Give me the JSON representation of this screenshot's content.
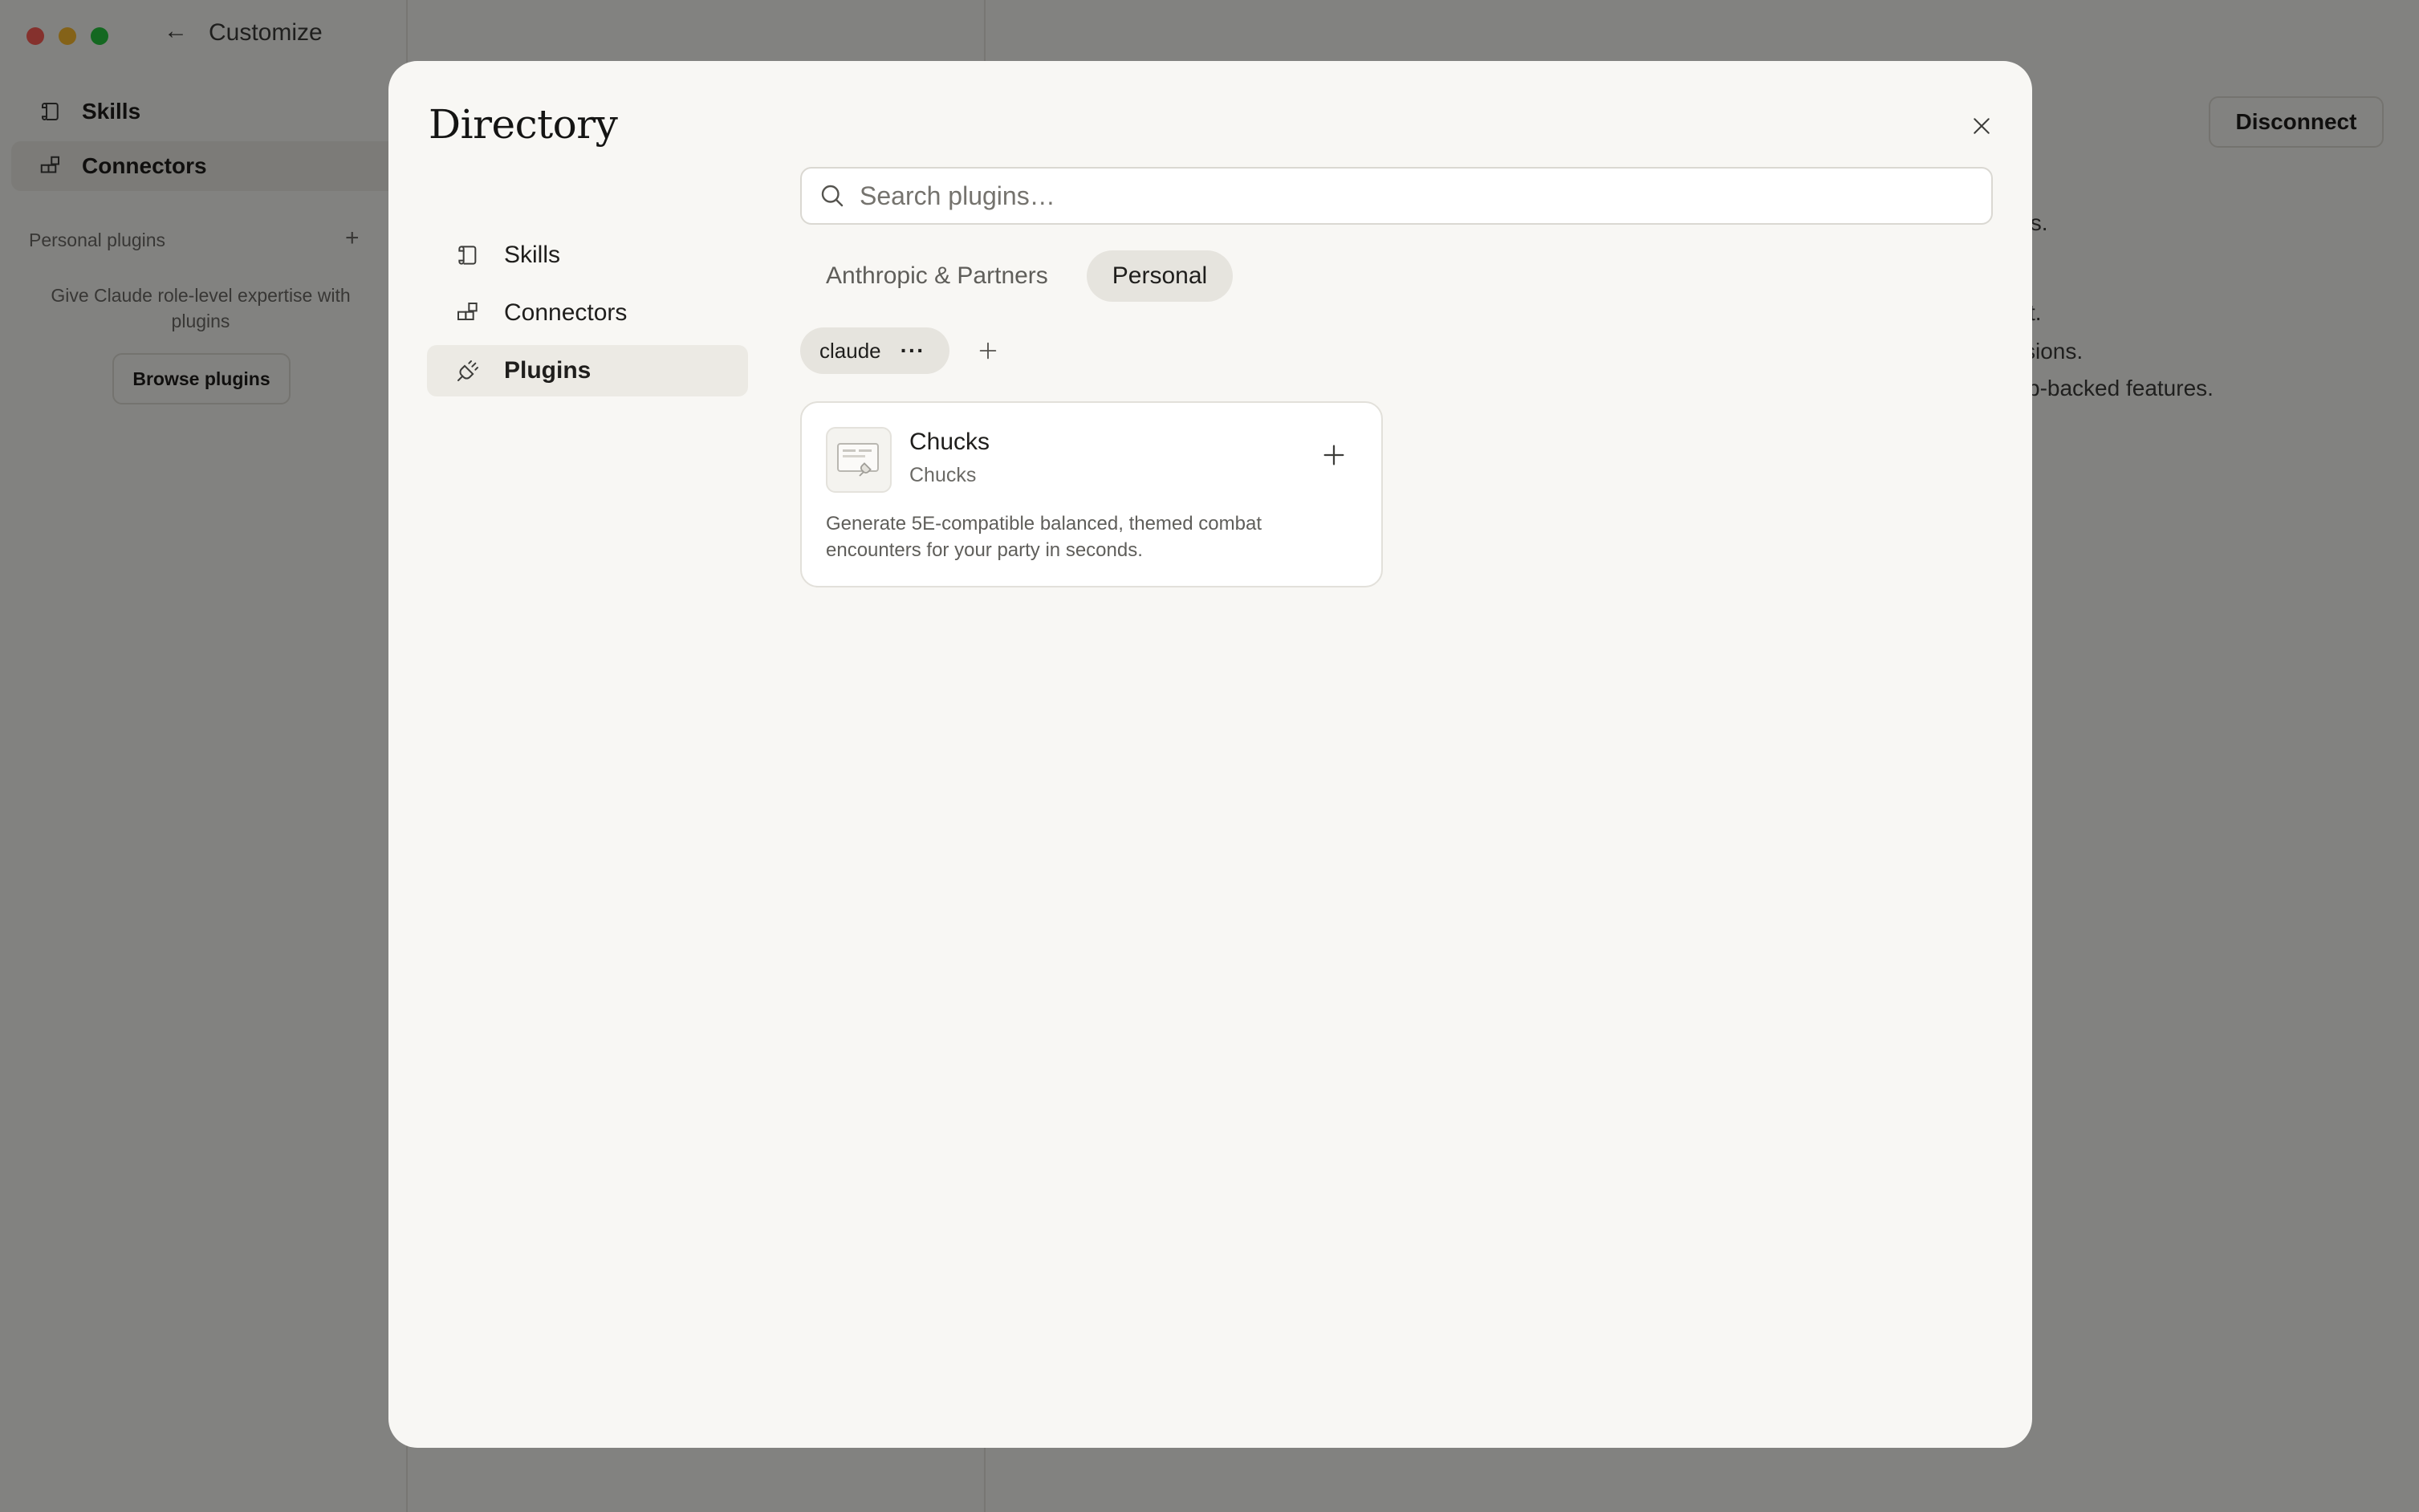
{
  "background": {
    "window_title": "Customize",
    "back_icon": "arrow-left-icon",
    "nav": [
      {
        "label": "Skills",
        "icon": "scroll-icon"
      },
      {
        "label": "Connectors",
        "icon": "blocks-icon"
      }
    ],
    "section_label": "Personal plugins",
    "helper_text": "Give Claude role-level expertise with plugins",
    "browse_label": "Browse plugins",
    "disconnect_label": "Disconnect",
    "text_fragments": [
      "ts.",
      "t.",
      "sions.",
      "b-backed features."
    ]
  },
  "modal": {
    "title": "Directory",
    "close_icon": "close-icon",
    "nav": [
      {
        "label": "Skills",
        "icon": "scroll-icon",
        "active": false
      },
      {
        "label": "Connectors",
        "icon": "blocks-icon",
        "active": false
      },
      {
        "label": "Plugins",
        "icon": "plug-icon",
        "active": true
      }
    ],
    "search": {
      "placeholder": "Search plugins…",
      "value": ""
    },
    "tabs": [
      {
        "label": "Anthropic & Partners",
        "active": false
      },
      {
        "label": "Personal",
        "active": true
      }
    ],
    "filter_chip": {
      "label": "claude",
      "more": "···"
    },
    "plugins": [
      {
        "name": "Chucks",
        "author": "Chucks",
        "description": "Generate 5E-compatible balanced, themed combat encounters for your party in seconds."
      }
    ]
  },
  "colors": {
    "modal_bg": "#f8f7f4",
    "active_tab_bg": "#e6e4de",
    "traffic_red": "#ff5f57",
    "traffic_yellow": "#febc2e",
    "traffic_green": "#28c840"
  }
}
